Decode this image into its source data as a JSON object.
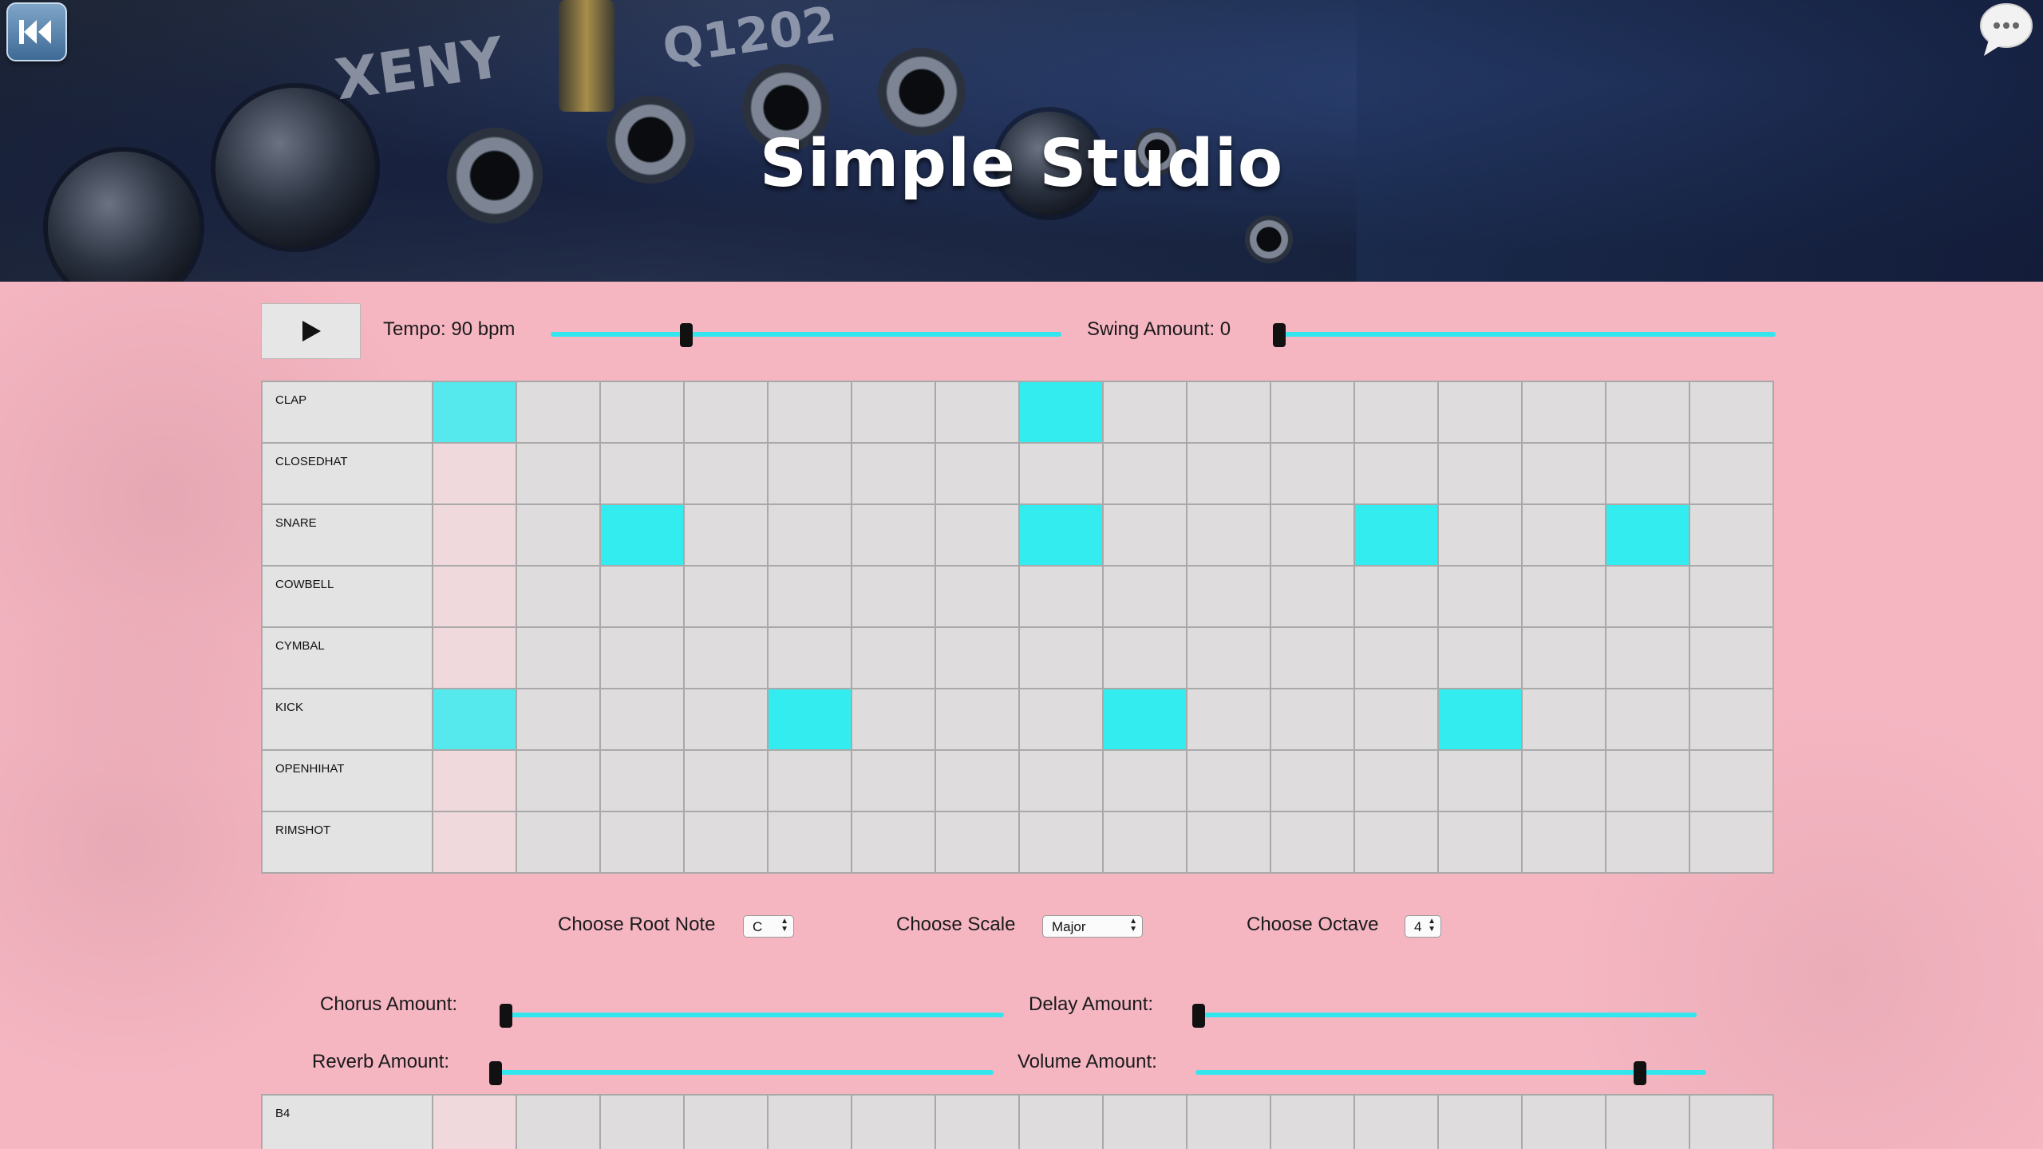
{
  "app": {
    "title": "Simple Studio"
  },
  "transport": {
    "tempo_label": "Tempo: 90 bpm",
    "tempo_value": 90,
    "tempo_fraction": 0.26,
    "swing_label": "Swing Amount: 0",
    "swing_fraction": 0.0
  },
  "drum_grid": {
    "steps": 16,
    "rows": [
      {
        "name": "CLAP",
        "active": [
          0,
          7
        ]
      },
      {
        "name": "CLOSEDHAT",
        "active": []
      },
      {
        "name": "SNARE",
        "active": [
          2,
          7,
          11,
          14
        ]
      },
      {
        "name": "COWBELL",
        "active": []
      },
      {
        "name": "CYMBAL",
        "active": []
      },
      {
        "name": "KICK",
        "active": [
          0,
          4,
          8,
          12
        ]
      },
      {
        "name": "OPENHIHAT",
        "active": []
      },
      {
        "name": "RIMSHOT",
        "active": []
      }
    ]
  },
  "music": {
    "root_label": "Choose Root Note",
    "root_value": "C",
    "scale_label": "Choose Scale",
    "scale_value": "Major",
    "octave_label": "Choose Octave",
    "octave_value": "4"
  },
  "effects": {
    "chorus_label": "Chorus Amount:",
    "chorus_fraction": 0.0,
    "delay_label": "Delay Amount:",
    "delay_fraction": 0.0,
    "reverb_label": "Reverb Amount:",
    "reverb_fraction": 0.0,
    "volume_label": "Volume Amount:",
    "volume_fraction": 0.88
  },
  "note_grid": {
    "rows": [
      {
        "name": "B4",
        "active": []
      }
    ]
  },
  "colors": {
    "accent": "#33ecf0",
    "page_bg": "#f5b6c2",
    "cell": "#dedcdc"
  },
  "icons": {
    "back": "rewind-icon",
    "chat": "chat-bubble-icon",
    "play": "play-icon"
  }
}
